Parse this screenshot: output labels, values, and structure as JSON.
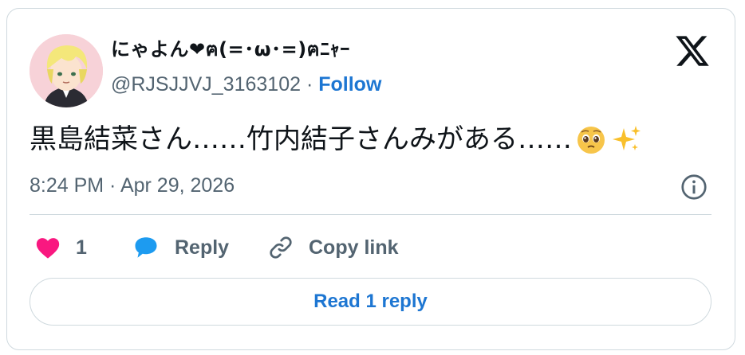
{
  "user": {
    "display_name": "にゃよん❤ฅ(=･ω･=)ฅﾆｬｰ",
    "handle": "@RJSJJVJ_3163102",
    "separator": "·",
    "follow_label": "Follow"
  },
  "tweet": {
    "text": "黒島結菜さん……竹内結子さんみがある……",
    "emojis": [
      "pleading-face",
      "sparkles"
    ],
    "timestamp": "8:24 PM · Apr 29, 2026"
  },
  "actions": {
    "like_count": "1",
    "reply_label": "Reply",
    "copy_link_label": "Copy link"
  },
  "read_replies_label": "Read 1 reply",
  "colors": {
    "accent": "#1d76d2",
    "like": "#f91880",
    "reply_icon": "#1d9bf0",
    "muted": "#536471",
    "border": "#cfd9de"
  },
  "icons": [
    "x-logo-icon",
    "info-icon",
    "heart-icon",
    "reply-bubble-icon",
    "link-icon"
  ]
}
